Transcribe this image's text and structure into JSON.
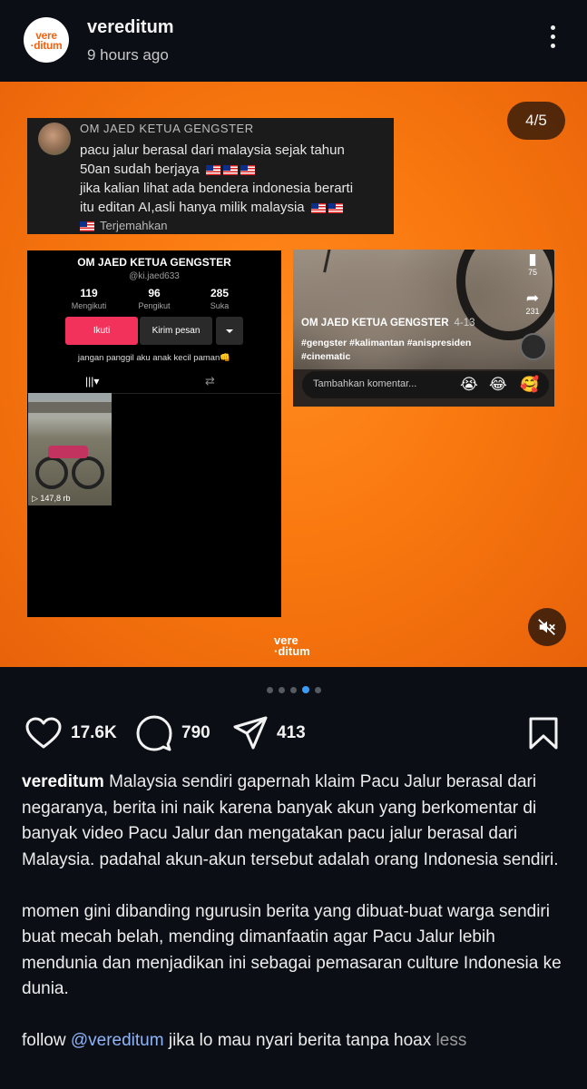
{
  "header": {
    "username": "vereditum",
    "time": "9 hours ago",
    "avatar_line1": "vere",
    "avatar_line2": "·ditum"
  },
  "media": {
    "counter": "4/5",
    "watermark_line1": "vere",
    "watermark_line2": "·ditum",
    "comment": {
      "name": "OM JAED KETUA GENGSTER",
      "line1": "pacu jalur berasal dari malaysia sejak tahun",
      "line2": "50an sudah berjaya",
      "line3": "jika kalian lihat ada bendera indonesia berarti",
      "line4": "itu editan AI,asli hanya milik malaysia",
      "translate": "Terjemahkan"
    },
    "profile": {
      "name": "OM JAED KETUA GENGSTER",
      "handle": "@ki.jaed633",
      "stats": [
        {
          "n": "119",
          "l": "Mengikuti"
        },
        {
          "n": "96",
          "l": "Pengikut"
        },
        {
          "n": "285",
          "l": "Suka"
        }
      ],
      "follow": "Ikuti",
      "message": "Kirim pesan",
      "bio": "jangan panggil aku anak kecil paman👊",
      "thumb_views": "▷ 147,8 rb"
    },
    "video": {
      "bookmark_count": "75",
      "share_count": "231",
      "name": "OM JAED KETUA GENGSTER",
      "date": "4-13",
      "tags_line1": "#gengster #kalimantan #anispresiden",
      "tags_line2": "#cinematic",
      "input_placeholder": "Tambahkan komentar...",
      "emojis": [
        "😭",
        "😂",
        "🥰"
      ]
    }
  },
  "carousel": {
    "count": 5,
    "active_index": 3
  },
  "actions": {
    "likes": "17.6K",
    "comments": "790",
    "shares": "413"
  },
  "caption": {
    "username": "vereditum",
    "para1": "Malaysia sendiri gapernah klaim Pacu Jalur berasal dari negaranya, berita ini naik karena banyak akun yang berkomentar di banyak video Pacu Jalur dan mengatakan pacu jalur berasal dari Malaysia. padahal akun-akun tersebut adalah orang Indonesia sendiri.",
    "para2": "momen gini dibanding ngurusin berita yang dibuat-buat warga sendiri buat mecah belah, mending dimanfaatin agar Pacu Jalur lebih mendunia dan menjadikan ini sebagai pemasaran culture Indonesia ke dunia.",
    "para3_prefix": "follow",
    "mention": "@vereditum",
    "para3_suffix": "jika lo mau nyari berita tanpa hoax",
    "less": "less"
  },
  "colors": {
    "background": "#0b0e14",
    "media_orange": "#f9780f",
    "accent_blue": "#3b9cf5",
    "mention": "#8fb4f8",
    "tiktok_follow": "#f2325a"
  }
}
